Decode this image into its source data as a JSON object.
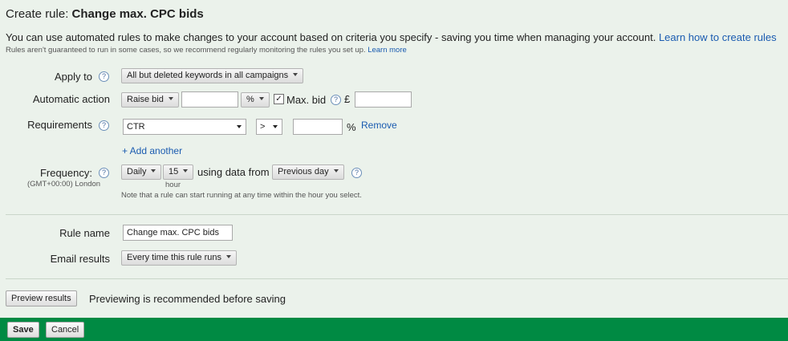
{
  "header": {
    "title_prefix": "Create rule: ",
    "title_name": "Change max. CPC bids"
  },
  "intro": {
    "text": "You can use automated rules to make changes to your account based on criteria you specify - saving you time when managing your account. ",
    "learn_link": "Learn how to create rules",
    "note": "Rules aren't guaranteed to run in some cases, so we recommend regularly monitoring the rules you set up. ",
    "note_link": "Learn more"
  },
  "apply_to": {
    "label": "Apply to",
    "value": "All but deleted keywords in all campaigns"
  },
  "action": {
    "label": "Automatic action",
    "type": "Raise bid",
    "amount": "",
    "unit": "%",
    "max_checked": true,
    "max_label": "Max. bid",
    "currency": "£",
    "max_value": ""
  },
  "requirements": {
    "label": "Requirements",
    "metric": "CTR",
    "operator": ">",
    "value": "",
    "unit": "%",
    "remove": "Remove",
    "add_another": "+ Add another"
  },
  "frequency": {
    "label": "Frequency:",
    "timezone": "(GMT+00:00) London",
    "period": "Daily",
    "hour": "15",
    "hour_label": "hour",
    "using_label": "using data from",
    "data_range": "Previous day",
    "note": "Note that a rule can start running at any time within the hour you select."
  },
  "rule_name": {
    "label": "Rule name",
    "value": "Change max. CPC bids"
  },
  "email": {
    "label": "Email results",
    "value": "Every time this rule runs"
  },
  "preview": {
    "button": "Preview results",
    "note": "Previewing is recommended before saving"
  },
  "footer": {
    "save": "Save",
    "cancel": "Cancel"
  },
  "colors": {
    "footer": "#008a43",
    "background": "#ebf2eb",
    "link": "#1a5bb0"
  }
}
